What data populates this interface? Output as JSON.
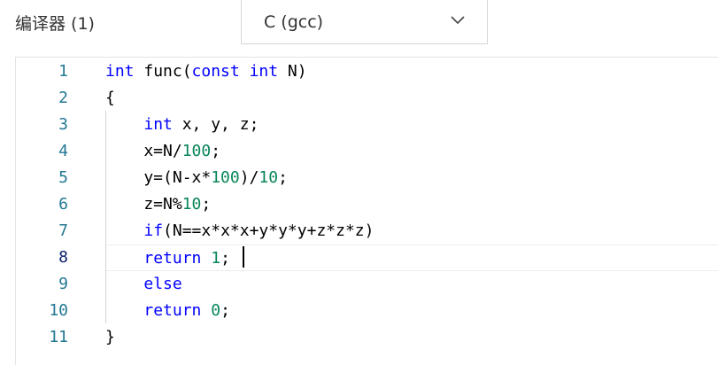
{
  "header": {
    "compiler_label": "编译器 (1)",
    "language_select": {
      "value": "C (gcc)",
      "icon": "chevron-down-icon"
    }
  },
  "editor": {
    "active_line": 8,
    "lines": [
      {
        "number": "1",
        "tokens": [
          [
            "keyword",
            "int"
          ],
          [
            "text",
            " func("
          ],
          [
            "keyword",
            "const"
          ],
          [
            "text",
            " "
          ],
          [
            "keyword",
            "int"
          ],
          [
            "text",
            " N)"
          ]
        ]
      },
      {
        "number": "2",
        "tokens": [
          [
            "text",
            "{"
          ]
        ]
      },
      {
        "number": "3",
        "tokens": [
          [
            "text",
            "    "
          ],
          [
            "keyword",
            "int"
          ],
          [
            "text",
            " x, y, z;"
          ]
        ]
      },
      {
        "number": "4",
        "tokens": [
          [
            "text",
            "    x=N/"
          ],
          [
            "number",
            "100"
          ],
          [
            "text",
            ";"
          ]
        ]
      },
      {
        "number": "5",
        "tokens": [
          [
            "text",
            "    y=(N-x*"
          ],
          [
            "number",
            "100"
          ],
          [
            "text",
            ")/"
          ],
          [
            "number",
            "10"
          ],
          [
            "text",
            ";"
          ]
        ]
      },
      {
        "number": "6",
        "tokens": [
          [
            "text",
            "    z=N%"
          ],
          [
            "number",
            "10"
          ],
          [
            "text",
            ";"
          ]
        ]
      },
      {
        "number": "7",
        "tokens": [
          [
            "text",
            "    "
          ],
          [
            "keyword",
            "if"
          ],
          [
            "text",
            "(N==x*x*x+y*y*y+z*z*z)"
          ]
        ]
      },
      {
        "number": "8",
        "tokens": [
          [
            "text",
            "    "
          ],
          [
            "keyword",
            "return"
          ],
          [
            "text",
            " "
          ],
          [
            "number",
            "1"
          ],
          [
            "text",
            ";"
          ]
        ]
      },
      {
        "number": "9",
        "tokens": [
          [
            "text",
            "    "
          ],
          [
            "keyword",
            "else"
          ]
        ]
      },
      {
        "number": "10",
        "tokens": [
          [
            "text",
            "    "
          ],
          [
            "keyword",
            "return"
          ],
          [
            "text",
            " "
          ],
          [
            "number",
            "0"
          ],
          [
            "text",
            ";"
          ]
        ]
      },
      {
        "number": "11",
        "tokens": [
          [
            "text",
            "}"
          ]
        ]
      }
    ]
  },
  "colors": {
    "keyword": "#0000ff",
    "number": "#098658",
    "line_number": "#237893",
    "active_line_number": "#0b216f"
  }
}
